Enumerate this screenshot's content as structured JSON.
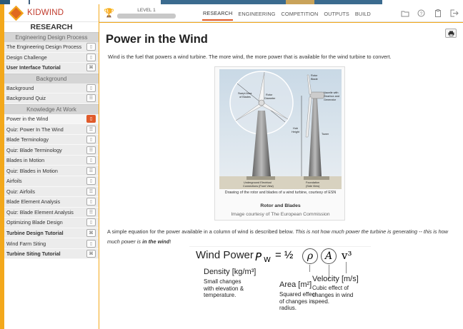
{
  "app": {
    "name": "KIDWIND",
    "section": "RESEARCH"
  },
  "sidebar": {
    "groups": [
      {
        "header": "Engineering Design Process",
        "items": [
          {
            "label": "The Engineering Design Process",
            "icon": "page-icon",
            "bold": false,
            "active": false
          },
          {
            "label": "Design Challenge",
            "icon": "page-icon",
            "bold": false,
            "active": false
          },
          {
            "label": "User Interface Tutorial",
            "icon": "tutorial-icon",
            "bold": true,
            "active": false
          }
        ]
      },
      {
        "header": "Background",
        "items": [
          {
            "label": "Background",
            "icon": "page-icon",
            "bold": false,
            "active": false
          },
          {
            "label": "Background Quiz",
            "icon": "quiz-icon",
            "bold": false,
            "active": false
          }
        ]
      },
      {
        "header": "Knowledge At Work",
        "items": [
          {
            "label": "Power in the Wind",
            "icon": "page-icon",
            "bold": false,
            "active": true
          },
          {
            "label": "Quiz: Power In The Wind",
            "icon": "quiz-icon",
            "bold": false,
            "active": false
          },
          {
            "label": "Blade Terminology",
            "icon": "page-icon",
            "bold": false,
            "active": false
          },
          {
            "label": "Quiz: Blade Terminology",
            "icon": "quiz-icon",
            "bold": false,
            "active": false
          },
          {
            "label": "Blades in Motion",
            "icon": "page-icon",
            "bold": false,
            "active": false
          },
          {
            "label": "Quiz: Blades in Motion",
            "icon": "quiz-icon",
            "bold": false,
            "active": false
          },
          {
            "label": "Airfoils",
            "icon": "page-icon",
            "bold": false,
            "active": false
          },
          {
            "label": "Quiz: Airfoils",
            "icon": "quiz-icon",
            "bold": false,
            "active": false
          },
          {
            "label": "Blade Element Analysis",
            "icon": "page-icon",
            "bold": false,
            "active": false
          },
          {
            "label": "Quiz: Blade Element Analysis",
            "icon": "quiz-icon",
            "bold": false,
            "active": false
          },
          {
            "label": "Optimizing Blade Design",
            "icon": "page-icon",
            "bold": false,
            "active": false
          },
          {
            "label": "Turbine Design Tutorial",
            "icon": "tutorial-icon",
            "bold": true,
            "active": false
          },
          {
            "label": "Wind Farm Siting",
            "icon": "page-icon",
            "bold": false,
            "active": false
          },
          {
            "label": "Turbine Siting Tutorial",
            "icon": "tutorial-icon",
            "bold": true,
            "active": false
          }
        ]
      }
    ]
  },
  "topbar": {
    "level_label": "LEVEL 1",
    "level_progress": 0,
    "tabs": [
      "RESEARCH",
      "ENGINEERING",
      "COMPETITION",
      "OUTPUTS",
      "BUILD"
    ],
    "active_tab": "RESEARCH",
    "icons": [
      "folder-icon",
      "help-icon",
      "clipboard-icon",
      "logout-icon"
    ]
  },
  "main": {
    "title": "Power in the Wind",
    "intro": "Wind is the fuel that powers a wind turbine. The more wind, the more power that is available for the wind turbine to convert.",
    "figure": {
      "labels": {
        "rotor_blade": "Rotor Blade",
        "swept_area": "Swept Area of Blades",
        "rotor_diameter": "Rotor Diameter",
        "nacelle": "Nacelle with Gearbox and Generator",
        "hub_height": "Hub Height",
        "tower": "Tower",
        "underground": "Underground Electrical Connections (Front View)",
        "foundation": "Foundation (Side View)"
      },
      "caption": "Drawing of the rotor and blades of a wind turbine, courtesy of ESN",
      "title": "Rotor and Blades",
      "credit": "Image courtesy of The European Commission"
    },
    "paragraph": {
      "plain": "A simple equation for the power available in a column of wind is described below. ",
      "italic": "This is not how much power the turbine is generating -- this is how much power is ",
      "bold_italic": "in the wind",
      "end": "!"
    },
    "equation": {
      "lhs": "Wind Power",
      "P": "P",
      "sub": "W",
      "half": "= ½",
      "rho": "ρ",
      "A": "A",
      "v": "v³",
      "density_title": "Density [kg/m³]",
      "density_desc": [
        "Small changes",
        "with elevation &",
        "temperature."
      ],
      "area_title": "Area [m²]",
      "area_desc": [
        "Squared effect",
        "of changes in",
        "radius."
      ],
      "velocity_title": "Velocity [m/s]",
      "velocity_desc": [
        "Cubic effect of",
        "changes in wind",
        "speed."
      ]
    }
  },
  "colors": {
    "accent": "#e05a2a",
    "frame": "#f3a81b",
    "brand_text": "#c03a2b"
  }
}
